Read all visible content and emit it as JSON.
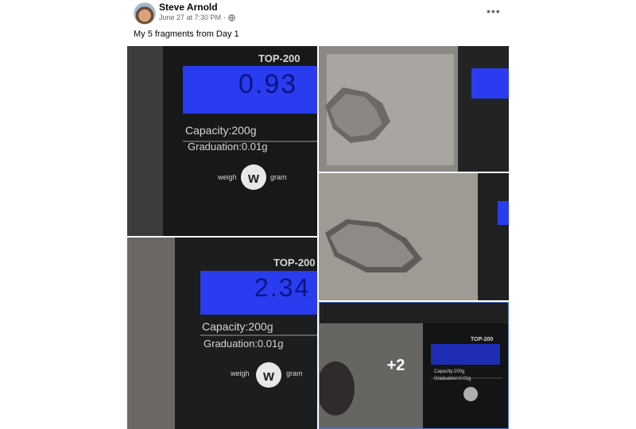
{
  "post": {
    "author": "Steve Arnold",
    "timestamp": "June 27 at 7:30 PM",
    "separator": "·",
    "audience_icon": "globe-icon",
    "more_label": "•••",
    "caption": "My 5 fragments from Day 1"
  },
  "photos": {
    "scale_model": "TOP-200",
    "capacity": "Capacity:200g",
    "graduation": "Graduation:0.01g",
    "brand_left": "weigh",
    "brand_right": "gram",
    "reading_1": "0.93",
    "reading_2": "2.34",
    "more_count": "+2"
  },
  "colors": {
    "display_blue": "#2a3cf0",
    "selected_border": "#4a7bd0",
    "meta_gray": "#65676b"
  }
}
